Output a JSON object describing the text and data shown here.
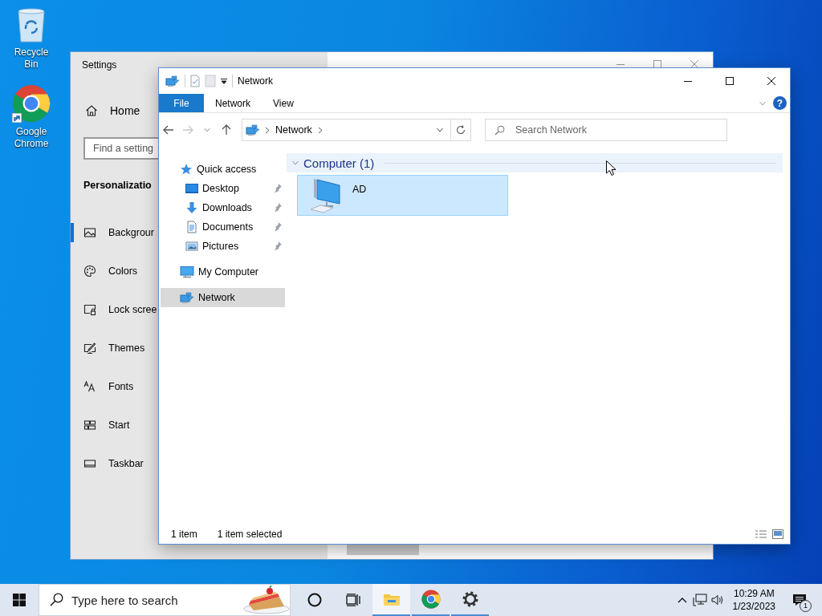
{
  "desktop_icons": [
    {
      "kind": "recycle",
      "label": "Recycle Bin"
    },
    {
      "kind": "browser",
      "label": "Google Chrome"
    }
  ],
  "settings_window": {
    "title": "Settings",
    "home": "Home",
    "search": {
      "placeholder": "Find a setting"
    },
    "section": "Personalizatio",
    "items": [
      {
        "kind": "background",
        "label": "Backgrour",
        "selected": true
      },
      {
        "kind": "colors",
        "label": "Colors",
        "selected": false
      },
      {
        "kind": "lock",
        "label": "Lock scree",
        "selected": false
      },
      {
        "kind": "themes",
        "label": "Themes",
        "selected": false
      },
      {
        "kind": "fonts",
        "label": "Fonts",
        "selected": false
      },
      {
        "kind": "start",
        "label": "Start",
        "selected": false
      },
      {
        "kind": "taskbar",
        "label": "Taskbar",
        "selected": false
      }
    ]
  },
  "explorer_window": {
    "title": "Network",
    "ribbon_tabs": [
      {
        "kind": "file",
        "label": "File"
      },
      {
        "kind": "tab",
        "label": "Network"
      },
      {
        "kind": "tab",
        "label": "View"
      }
    ],
    "help": "?",
    "address": {
      "path": [
        "Network"
      ]
    },
    "search": {
      "placeholder": "Search Network"
    },
    "navigation": [
      {
        "kind": "star",
        "label": "Quick access",
        "selected": false,
        "children": [
          {
            "kind": "desktop",
            "label": "Desktop",
            "pinned": true,
            "selected": false
          },
          {
            "kind": "download",
            "label": "Downloads",
            "pinned": true,
            "selected": false
          },
          {
            "kind": "document",
            "label": "Documents",
            "pinned": true,
            "selected": false
          },
          {
            "kind": "pictures",
            "label": "Pictures",
            "pinned": true,
            "selected": false
          }
        ]
      },
      {
        "kind": "computer",
        "label": "My Computer",
        "selected": false
      },
      {
        "kind": "network",
        "label": "Network",
        "selected": true
      }
    ],
    "groups": [
      {
        "label": "Computer (1)",
        "expanded": true,
        "items": [
          {
            "name": "AD",
            "selected": true
          }
        ]
      }
    ],
    "status_bar": [
      "1 item",
      "1 item selected"
    ]
  },
  "taskbar": {
    "search": {
      "placeholder": "Type here to search"
    },
    "apps": [
      {
        "kind": "folder",
        "active": true
      },
      {
        "kind": "browser",
        "active": false
      },
      {
        "kind": "gear",
        "active": false
      }
    ],
    "clock": {
      "time": "10:29 AM",
      "date": "1/23/2023"
    },
    "notifications": "1"
  }
}
